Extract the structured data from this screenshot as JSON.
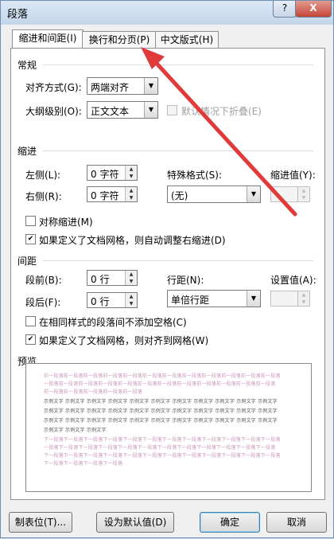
{
  "window": {
    "title": "段落",
    "help": "?",
    "close": "X"
  },
  "tabs": [
    {
      "label": "缩进和间距(I)"
    },
    {
      "label": "换行和分页(P)"
    },
    {
      "label": "中文版式(H)"
    }
  ],
  "general": {
    "heading": "常规",
    "align_label": "对齐方式(G):",
    "align_value": "两端对齐",
    "outline_label": "大纲级别(O):",
    "outline_value": "正文文本",
    "collapse_label": "默认情况下折叠(E)"
  },
  "indent": {
    "heading": "缩进",
    "left_label": "左侧(L):",
    "left_value": "0 字符",
    "right_label": "右侧(R):",
    "right_value": "0 字符",
    "special_label": "特殊格式(S):",
    "special_value": "(无)",
    "by_label": "缩进值(Y):",
    "by_value": "",
    "mirror_label": "对称缩进(M)",
    "mirror_checked": false,
    "auto_adjust_label": "如果定义了文档网格，则自动调整右缩进(D)",
    "auto_adjust_checked": true
  },
  "spacing": {
    "heading": "间距",
    "before_label": "段前(B):",
    "before_value": "0 行",
    "after_label": "段后(F):",
    "after_value": "0 行",
    "line_label": "行距(N):",
    "line_value": "单倍行距",
    "at_label": "设置值(A):",
    "at_value": "",
    "no_space_label": "在相同样式的段落间不添加空格(C)",
    "no_space_checked": false,
    "snap_label": "如果定义了文档网格，则对齐到网格(W)",
    "snap_checked": true
  },
  "preview": {
    "heading": "预览",
    "prev_line1": "前一段落前一段落前一段落前一段落前一段落前一段落前一段落前一段落前一段落前一段落前一段落前一段落",
    "prev_line2": "一段落前一段落前一段落前一段落前一段落前一段落前一段落前一段落前一段落前一段落前一段落前一段落",
    "prev_line3": "前一段落前一段落前一段落前一段落前一段落",
    "sample_line1": "示例文字 示例文字 示例文字 示例文字 示例文字 示例文字 示例文字 示例文字 示例文字 示例文字 示例文字",
    "sample_line2": "示例文字 示例文字 示例文字 示例文字 示例文字 示例文字 示例文字 示例文字 示例文字 示例文字 示例文字",
    "sample_line3": "示例文字 示例文字 示例文字 示例文字 示例文字 示例文字 示例文字 示例文字 示例文字 示例文字 示例文字",
    "sample_line4": "示例文字 示例文字 示例文字",
    "next_line1": "下一段落下一段落下一段落下一段落下一段落下一段落下一段落下一段落下一段落下一段落下一段落下一段落",
    "next_line2": "一段落下一段落下一段落下一段落下一段落下一段落下一段落下一段落下一段落下一段落下一段落下一段落",
    "next_line3": "下一段落下一段落下一段落下一段落下一段落下一段落下一段落下一段落下一段落下一段落下一段落下一段落",
    "next_line4": "下一段落下一段落下一段落下一段落"
  },
  "buttons": {
    "tabs": "制表位(T)...",
    "set_default": "设为默认值(D)",
    "ok": "确定",
    "cancel": "取消"
  },
  "colors": {
    "annotation_arrow": "#e03a3a"
  }
}
